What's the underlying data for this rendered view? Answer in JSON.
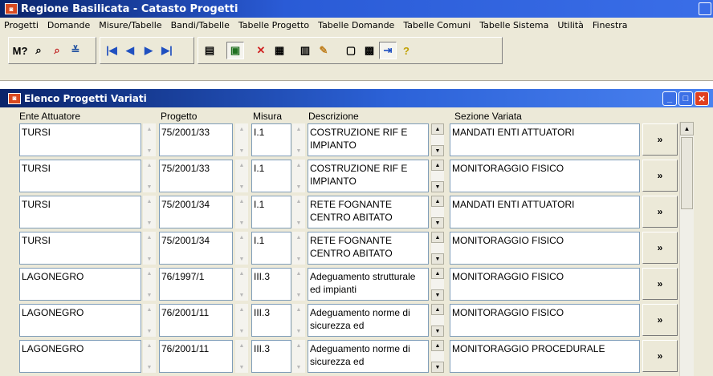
{
  "app": {
    "title": "Regione Basilicata - Catasto Progetti",
    "icon": "app-icon"
  },
  "menu": [
    "Progetti",
    "Domande",
    "Misure/Tabelle",
    "Bandi/Tabelle",
    "Tabelle Progetto",
    "Tabelle Domande",
    "Tabelle Comuni",
    "Tabelle Sistema",
    "Utilità",
    "Finestra"
  ],
  "toolbar": {
    "groups": [
      {
        "icons": [
          "query-icon",
          "find-icon",
          "find-red-icon",
          "filter-icon"
        ]
      },
      {
        "icons": [
          "first-record-icon",
          "prev-record-icon",
          "next-record-icon",
          "last-record-icon"
        ]
      },
      {
        "icons": [
          "new-record-icon",
          "edit-record-icon",
          "delete-icon",
          "save-icon",
          "copy-icon",
          "write-icon",
          "view-icon",
          "print-icon",
          "exit-icon",
          "help-icon"
        ]
      }
    ],
    "glyphs": {
      "first": "|◀",
      "prev": "◀",
      "next": "▶",
      "last": "▶|",
      "help": "?",
      "delete": "✕"
    }
  },
  "child_window": {
    "title": "Elenco Progetti Variati"
  },
  "grid": {
    "columns": [
      "Ente Attuatore",
      "Progetto",
      "Misura",
      "Descrizione",
      "Sezione Variata"
    ],
    "rows": [
      {
        "ente": "TURSI",
        "progetto": "75/2001/33",
        "misura": "I.1",
        "descrizione": "COSTRUZIONE RIF E IMPIANTO",
        "sezione": "MANDATI ENTI ATTUATORI"
      },
      {
        "ente": "TURSI",
        "progetto": "75/2001/33",
        "misura": "I.1",
        "descrizione": "COSTRUZIONE RIF E IMPIANTO",
        "sezione": "MONITORAGGIO FISICO"
      },
      {
        "ente": "TURSI",
        "progetto": "75/2001/34",
        "misura": "I.1",
        "descrizione": "RETE FOGNANTE CENTRO ABITATO",
        "sezione": "MANDATI ENTI ATTUATORI"
      },
      {
        "ente": "TURSI",
        "progetto": "75/2001/34",
        "misura": "I.1",
        "descrizione": "RETE FOGNANTE CENTRO ABITATO",
        "sezione": "MONITORAGGIO FISICO"
      },
      {
        "ente": "LAGONEGRO",
        "progetto": "76/1997/1",
        "misura": "III.3",
        "descrizione": "Adeguamento strutturale ed impianti",
        "sezione": "MONITORAGGIO FISICO"
      },
      {
        "ente": "LAGONEGRO",
        "progetto": "76/2001/11",
        "misura": "III.3",
        "descrizione": "Adeguamento norme di sicurezza ed",
        "sezione": "MONITORAGGIO FISICO"
      },
      {
        "ente": "LAGONEGRO",
        "progetto": "76/2001/11",
        "misura": "III.3",
        "descrizione": "Adeguamento norme di sicurezza ed",
        "sezione": "MONITORAGGIO PROCEDURALE"
      }
    ],
    "detail_button_label": "»"
  }
}
